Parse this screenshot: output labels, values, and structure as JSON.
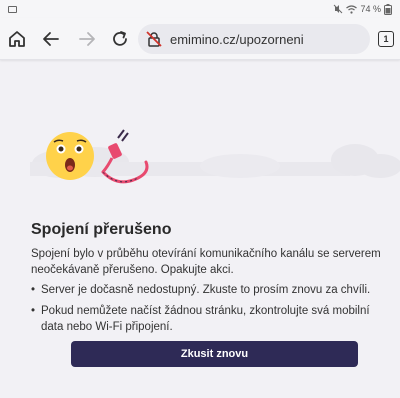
{
  "status_bar": {
    "battery": "74 %"
  },
  "browser": {
    "url": "emimino.cz/upozorneni",
    "tab_count": "1"
  },
  "page": {
    "title": "Spojení přerušeno",
    "description": "Spojení bylo v průběhu otevírání komunikačního kanálu se serverem neočekávaně přerušeno. Opakujte akci.",
    "bullets": [
      "Server je dočasně nedostupný. Zkuste to prosím znovu za chvíli.",
      "Pokud nemůžete načíst žádnou stránku, zkontrolujte svá mobilní data nebo Wi-Fi připojení."
    ],
    "retry_label": "Zkusit znovu"
  },
  "colors": {
    "button_bg": "#2e2a56",
    "emoji_yellow": "#ffd24a",
    "plug_pink": "#e84a6f"
  },
  "icons": [
    "gallery-icon",
    "mute-icon",
    "wifi-icon",
    "home-icon",
    "back-icon",
    "forward-icon",
    "reload-icon",
    "connection-warning-icon",
    "tabs-icon",
    "shocked-face-icon",
    "unplugged-cable-icon"
  ]
}
